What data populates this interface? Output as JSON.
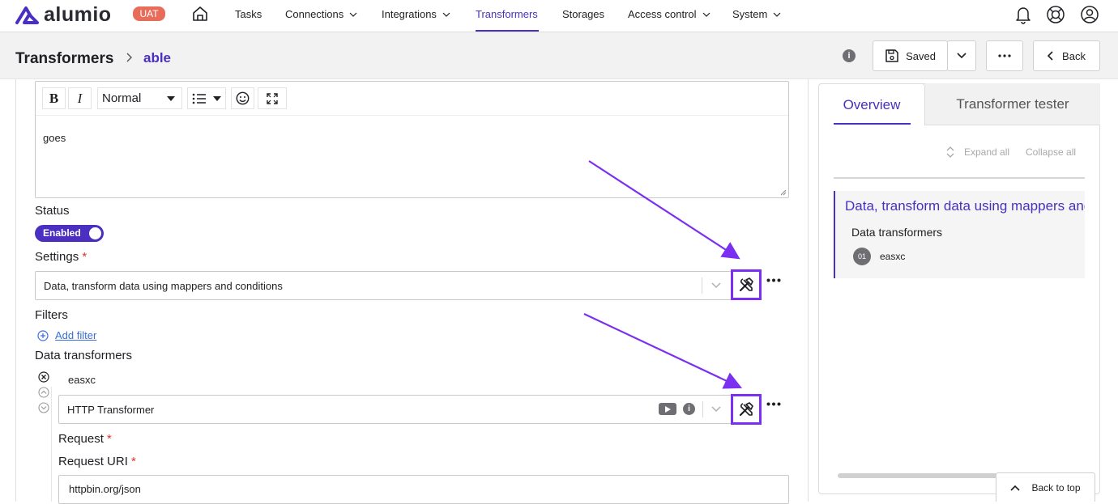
{
  "app": {
    "logo_text": "alumio",
    "env_badge": "UAT"
  },
  "nav": {
    "items": [
      {
        "label": "Tasks"
      },
      {
        "label": "Connections"
      },
      {
        "label": "Integrations"
      },
      {
        "label": "Transformers",
        "active": true
      },
      {
        "label": "Storages"
      },
      {
        "label": "Access control"
      },
      {
        "label": "System"
      }
    ]
  },
  "header": {
    "title": "Transformers",
    "breadcrumb_current": "able",
    "saved_label": "Saved",
    "back_label": "Back"
  },
  "editor": {
    "format_select": "Normal",
    "content": "goes"
  },
  "form": {
    "status_label": "Status",
    "status_toggle": "Enabled",
    "settings_label": "Settings",
    "settings_value": "Data, transform data using mappers and conditions",
    "filters_label": "Filters",
    "add_filter": "Add filter",
    "data_transformers_label": "Data transformers",
    "transformer_name": "easxc",
    "transformer_type": "HTTP Transformer",
    "request_label": "Request",
    "request_uri_label": "Request URI",
    "request_uri_value": "httpbin.org/json",
    "required_mark": "*"
  },
  "right_panel": {
    "tabs": [
      {
        "label": "Overview"
      },
      {
        "label": "Transformer tester"
      }
    ],
    "expand_all": "Expand all",
    "collapse_all": "Collapse all",
    "overview_title": "Data, transform data using mappers and conditions",
    "overview_sub": "Data transformers",
    "overview_item_num": "01",
    "overview_item_name": "easxc"
  },
  "back_to_top": "Back to top",
  "colors": {
    "accent": "#4b2fc0",
    "highlight": "#7b2ff0",
    "badge": "#e86c5a"
  }
}
